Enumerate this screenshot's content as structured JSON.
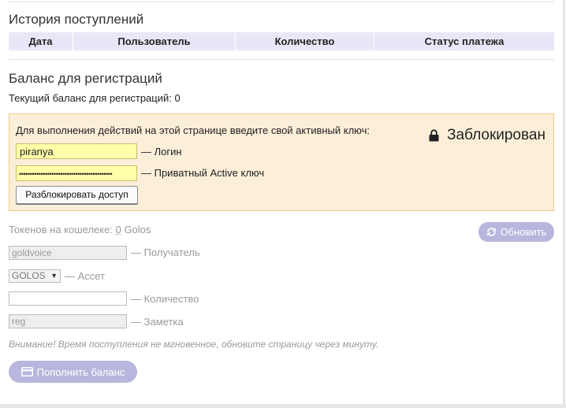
{
  "history": {
    "title": "История поступлений",
    "columns": [
      "Дата",
      "Пользователь",
      "Количество",
      "Статус платежа"
    ]
  },
  "balance": {
    "title": "Баланс для регистраций",
    "current": "Текущий баланс для регистраций: 0"
  },
  "auth": {
    "prompt": "Для выполнения действий на этой странице введите свой активный ключ:",
    "status": "Заблокирован",
    "login_value": "piranya",
    "login_label": "— Логин",
    "key_value": "•••••••••••••••••••••••••••••••••••••••••••",
    "key_label": "— Приватный Active ключ",
    "unlock_button": "Разблокировать доступ"
  },
  "wallet": {
    "tokens_label": "Токенов на кошелеке:",
    "tokens_value": "0",
    "tokens_unit": "Golos",
    "refresh_button": "Обновить"
  },
  "form": {
    "recipient_value": "goldvoice",
    "recipient_label": "— Получатель",
    "asset_value": "GOLOS",
    "asset_label": "— Ассет",
    "amount_value": "",
    "amount_label": "— Количество",
    "memo_value": "reg",
    "memo_label": "— Заметка",
    "notice": "Внимание! Время поступления не мгновенное, обновите страницу через минуту.",
    "submit_button": "Пополнить баланс"
  },
  "colors": {
    "accent_button": "#b9b6de",
    "table_header": "#e8e7f7",
    "lock_panel_bg": "#fcefd9",
    "lock_panel_border": "#f3c98b",
    "key_input_bg": "#ffffaa"
  }
}
